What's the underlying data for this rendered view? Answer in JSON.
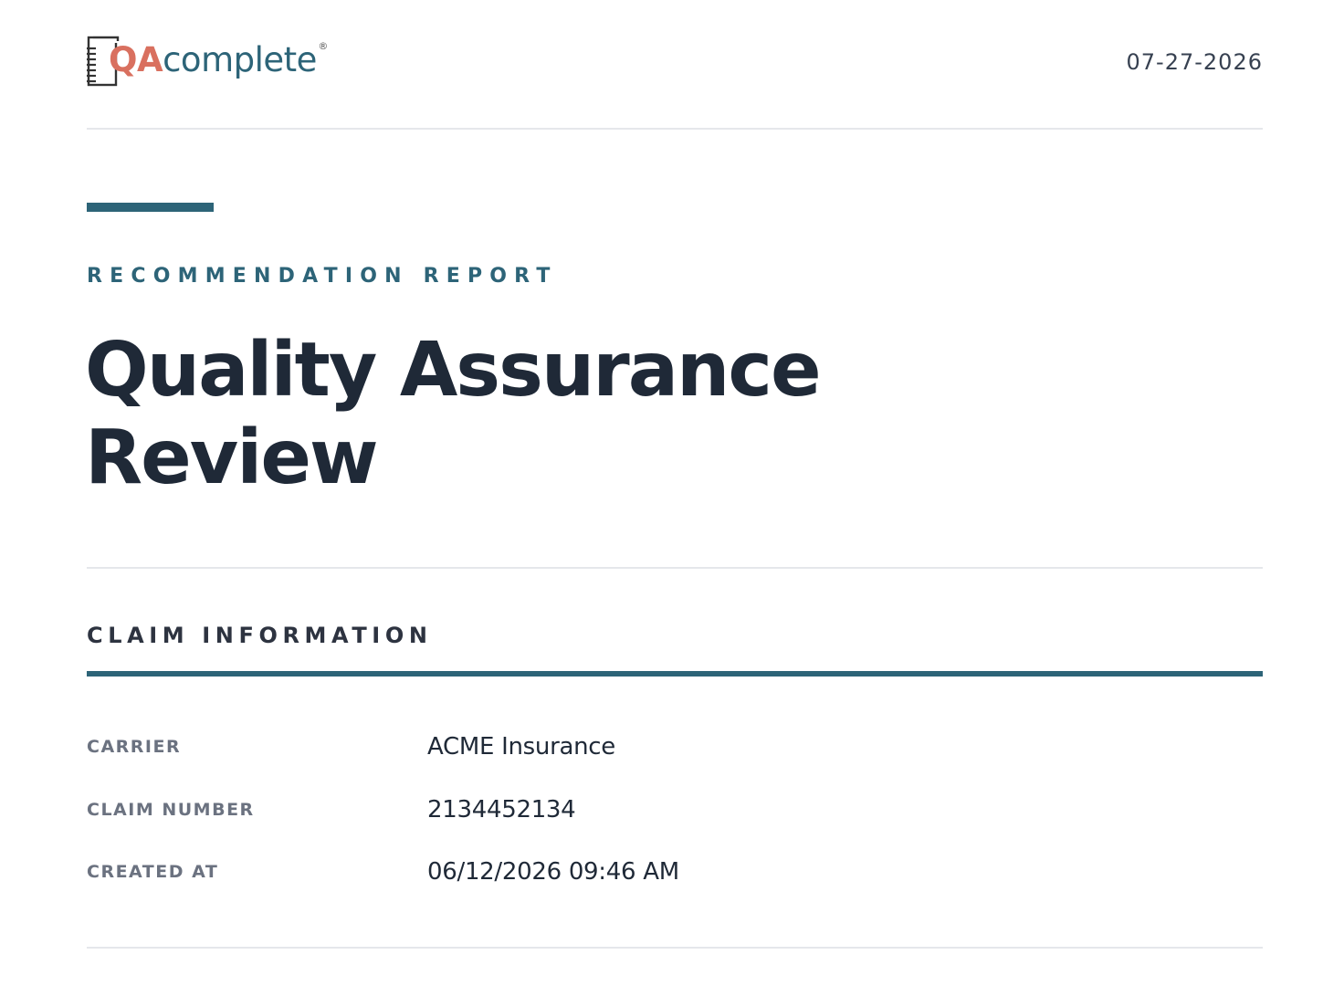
{
  "header": {
    "logo": {
      "icon": "document-lines-icon",
      "text_qa": "QA",
      "text_complete": "complete",
      "registered_mark": "®",
      "colors": {
        "qa": "#d9705f",
        "complete": "#2d6478"
      }
    },
    "date": "07-27-2026"
  },
  "report": {
    "eyebrow": "RECOMMENDATION REPORT",
    "title_line1": "Quality Assurance",
    "title_line2": "Review"
  },
  "claim_information": {
    "heading": "CLAIM INFORMATION",
    "rows": [
      {
        "label": "CARRIER",
        "value": "ACME Insurance"
      },
      {
        "label": "CLAIM NUMBER",
        "value": "2134452134"
      },
      {
        "label": "CREATED AT",
        "value": "06/12/2026 09:46 AM"
      }
    ]
  },
  "colors": {
    "accent": "#2d6478",
    "text_dark": "#1f2937",
    "label_gray": "#6b7280",
    "rule": "#e5e7eb"
  }
}
